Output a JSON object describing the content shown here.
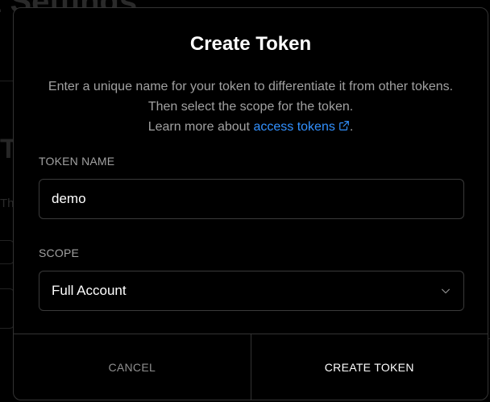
{
  "background": {
    "title_fragment": "t Settings",
    "letter": "T",
    "small_letter": "Th"
  },
  "modal": {
    "title": "Create Token",
    "description_line1": "Enter a unique name for your token to differentiate it from other tokens. Then select the scope for the token.",
    "description_prefix": "Learn more about",
    "link_text": "access tokens",
    "description_suffix": ".",
    "token_name": {
      "label": "TOKEN NAME",
      "value": "demo"
    },
    "scope": {
      "label": "SCOPE",
      "selected": "Full Account"
    },
    "buttons": {
      "cancel": "CANCEL",
      "create": "CREATE TOKEN"
    }
  },
  "colors": {
    "link": "#3291ff",
    "border": "#333333",
    "muted_text": "#a1a1a1"
  },
  "icons": {
    "external_link": "external-link-icon",
    "dropdown": "chevron-down-icon"
  }
}
